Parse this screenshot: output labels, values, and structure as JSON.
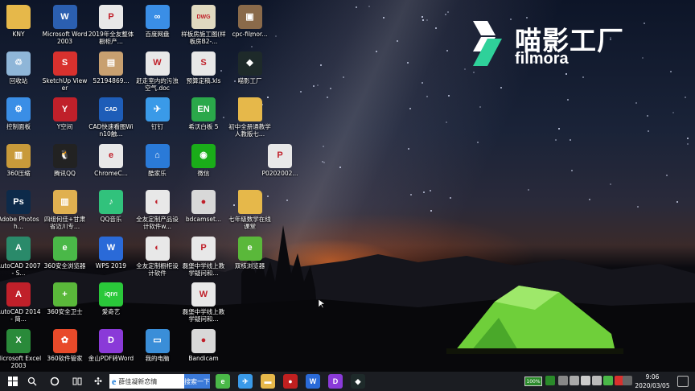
{
  "watermark": {
    "cn": "喵影工厂",
    "en": "filmora"
  },
  "desktop_icons": [
    {
      "label": "KNY",
      "icon": "folder-icon",
      "color": "#e6b84a",
      "glyph": ""
    },
    {
      "label": "Microsoft Word 2003",
      "icon": "word-icon",
      "color": "#2b5fb0",
      "glyph": "W"
    },
    {
      "label": "2019年全友整体橱柜产...",
      "icon": "pdf-icon",
      "color": "#e8e8e8",
      "glyph": "P"
    },
    {
      "label": "百度网盘",
      "icon": "baidu-netdisk-icon",
      "color": "#3a8ee6",
      "glyph": "∞"
    },
    {
      "label": "样板房施工图(样板房B2-...",
      "icon": "dwg-file-icon",
      "color": "#e0d9c0",
      "glyph": "DWG"
    },
    {
      "label": "cpc-filmor...",
      "icon": "archive-icon",
      "color": "#8a6a4a",
      "glyph": "▣"
    },
    {
      "label": "回收站",
      "icon": "recycle-bin-icon",
      "color": "#8fb6d8",
      "glyph": "♲"
    },
    {
      "label": "SketchUp Viewer",
      "icon": "sketchup-icon",
      "color": "#d8312e",
      "glyph": "S"
    },
    {
      "label": "521948​69...",
      "icon": "image-file-icon",
      "color": "#c8a070",
      "glyph": "▤"
    },
    {
      "label": "赶走室内的污浊空气.doc",
      "icon": "doc-file-icon",
      "color": "#e8e8e8",
      "glyph": "W"
    },
    {
      "label": "预算定稿.xls",
      "icon": "xls-file-icon",
      "color": "#e8e8e8",
      "glyph": "S"
    },
    {
      "label": "喵影工厂",
      "icon": "filmora-icon",
      "color": "#1e2a2a",
      "glyph": "◆"
    },
    {
      "label": "控制面板",
      "icon": "control-panel-icon",
      "color": "#3a8ee6",
      "glyph": "⚙"
    },
    {
      "label": "Y空间",
      "icon": "y-space-icon",
      "color": "#c0202a",
      "glyph": "Y"
    },
    {
      "label": "CAD快速看图Win10触...",
      "icon": "cad-viewer-icon",
      "color": "#1e5db8",
      "glyph": "CAD"
    },
    {
      "label": "钉钉",
      "icon": "dingtalk-icon",
      "color": "#3a9ae8",
      "glyph": "✈"
    },
    {
      "label": "希沃白板 5",
      "icon": "easinote-icon",
      "color": "#2aa84a",
      "glyph": "EN"
    },
    {
      "label": "初中全册通教学人教版七...",
      "icon": "folder-icon",
      "color": "#e6b84a",
      "glyph": ""
    },
    {
      "label": "360压缩",
      "icon": "360zip-icon",
      "color": "#c89a3a",
      "glyph": "▥"
    },
    {
      "label": "腾讯QQ",
      "icon": "qq-icon",
      "color": "#222",
      "glyph": "🐧"
    },
    {
      "label": "ChromeC...",
      "icon": "chrome-icon",
      "color": "#e8e8e8",
      "glyph": "e"
    },
    {
      "label": "酷家乐",
      "icon": "kujiale-icon",
      "color": "#2a7ad8",
      "glyph": "⌂"
    },
    {
      "label": "微信",
      "icon": "wechat-icon",
      "color": "#1aad19",
      "glyph": "◉"
    },
    {
      "label": "P0202002...",
      "icon": "pdf-icon",
      "color": "#e8e8e8",
      "glyph": "P"
    },
    {
      "label": "Adobe Photosh...",
      "icon": "photoshop-icon",
      "color": "#0d2a4a",
      "glyph": "Ps"
    },
    {
      "label": "四组何佳+甘肃省迈川专...",
      "icon": "archive-icon",
      "color": "#e0b050",
      "glyph": "▥"
    },
    {
      "label": "QQ音乐",
      "icon": "qq-music-icon",
      "color": "#31c27c",
      "glyph": "♪"
    },
    {
      "label": "全友定制产品设计软件w...",
      "icon": "design-software-icon",
      "color": "#e8e8e8",
      "glyph": "◐"
    },
    {
      "label": "bdcamset...",
      "icon": "bandicam-setup-icon",
      "color": "#d8d8d8",
      "glyph": "●"
    },
    {
      "label": "七年级数学在线课堂",
      "icon": "folder-icon",
      "color": "#e6b84a",
      "glyph": ""
    },
    {
      "label": "AutoCAD 2007 - S...",
      "icon": "autocad-icon",
      "color": "#2a8a6a",
      "glyph": "A"
    },
    {
      "label": "360安全浏览器",
      "icon": "360-browser-icon",
      "color": "#4ab848",
      "glyph": "e"
    },
    {
      "label": "WPS 2019",
      "icon": "wps-icon",
      "color": "#2a6ad8",
      "glyph": "W"
    },
    {
      "label": "全友定制橱柜设计软件",
      "icon": "design-software-icon",
      "color": "#e8e8e8",
      "glyph": "◐"
    },
    {
      "label": "磊堡中学线上教学疑问和...",
      "icon": "pdf-icon",
      "color": "#e8e8e8",
      "glyph": "P"
    },
    {
      "label": "双核浏览器",
      "icon": "dual-core-browser-icon",
      "color": "#5ab83a",
      "glyph": "e"
    },
    {
      "label": "AutoCAD 2014 - 简...",
      "icon": "autocad-icon",
      "color": "#c0202a",
      "glyph": "A"
    },
    {
      "label": "360安全卫士",
      "icon": "360-security-icon",
      "color": "#5ab83a",
      "glyph": "+"
    },
    {
      "label": "爱奇艺",
      "icon": "iqiyi-icon",
      "color": "#2ac83a",
      "glyph": "iQIYI"
    },
    {
      "label": "磊堡中学线上教学疑问和...",
      "icon": "doc-file-icon",
      "color": "#e8e8e8",
      "glyph": "W"
    },
    {
      "label": "Microsoft Excel 2003",
      "icon": "excel-icon",
      "color": "#2a8a3a",
      "glyph": "X"
    },
    {
      "label": "360软件管家",
      "icon": "360-software-icon",
      "color": "#e84a2a",
      "glyph": "✿"
    },
    {
      "label": "金山PDF转Word",
      "icon": "pdf-to-word-icon",
      "color": "#8a3ad8",
      "glyph": "D"
    },
    {
      "label": "我的电脑",
      "icon": "computer-icon",
      "color": "#3a8ed8",
      "glyph": "▭"
    },
    {
      "label": "Bandicam",
      "icon": "bandicam-icon",
      "color": "#d8d8d8",
      "glyph": "●"
    }
  ],
  "taskbar": {
    "search_text": "薛佳凝新恋情",
    "search_button": "搜索一下",
    "battery": "100%",
    "time": "9:06",
    "date": "2020/03/05",
    "start_icon": "windows-start-icon",
    "apps": [
      {
        "name": "360-browser-icon",
        "color": "#4ab848",
        "glyph": "e"
      },
      {
        "name": "dingtalk-icon",
        "color": "#3a9ae8",
        "glyph": "✈"
      },
      {
        "name": "file-explorer-icon",
        "color": "#e6b84a",
        "glyph": "▬"
      },
      {
        "name": "recorder-icon",
        "color": "#c02020",
        "glyph": "●"
      },
      {
        "name": "wps-icon",
        "color": "#2a6ad8",
        "glyph": "W"
      },
      {
        "name": "pdf-to-word-icon",
        "color": "#8a3ad8",
        "glyph": "D"
      },
      {
        "name": "filmora-icon",
        "color": "#1e2a2a",
        "glyph": "◆"
      }
    ]
  }
}
